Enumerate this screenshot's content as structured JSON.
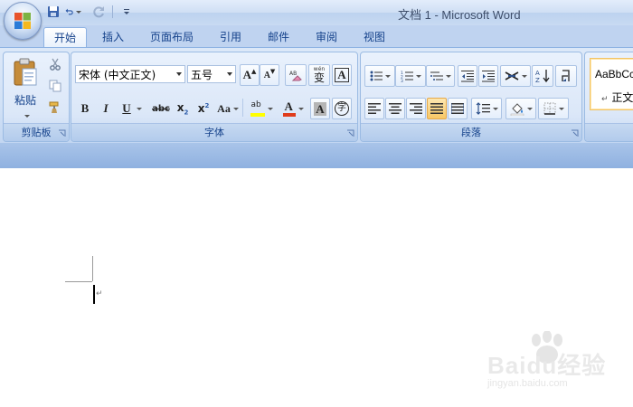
{
  "window": {
    "title": "文档 1 - Microsoft Word"
  },
  "tabs": [
    {
      "label": "开始",
      "active": true
    },
    {
      "label": "插入"
    },
    {
      "label": "页面布局"
    },
    {
      "label": "引用"
    },
    {
      "label": "邮件"
    },
    {
      "label": "审阅"
    },
    {
      "label": "视图"
    }
  ],
  "clipboard": {
    "paste_label": "粘贴",
    "group_label": "剪贴板"
  },
  "font": {
    "font_name": "宋体 (中文正文)",
    "font_size": "五号",
    "grow_label": "A",
    "shrink_label": "A",
    "pinyin_label": "wén",
    "pinyin_char": "变",
    "border_char": "A",
    "bold": "B",
    "italic": "I",
    "underline": "U",
    "strike": "abc",
    "sub_x": "x",
    "sub_2": "2",
    "sup_x": "x",
    "sup_2": "2",
    "case": "Aa",
    "highlight_label": "ab",
    "color_label": "A",
    "shade_char": "A",
    "enclose_char": "字",
    "group_label": "字体"
  },
  "paragraph": {
    "group_label": "段落"
  },
  "styles": {
    "preview_text": "AaBbCcDc",
    "normal_label": "正文"
  },
  "watermark": {
    "brand": "Baidu经验",
    "url": "jingyan.baidu.com"
  },
  "colors": {
    "accent": "#15428b",
    "ribbon": "#dbe7f8",
    "highlight": "#ffff00",
    "font_color": "#e03c1c"
  }
}
